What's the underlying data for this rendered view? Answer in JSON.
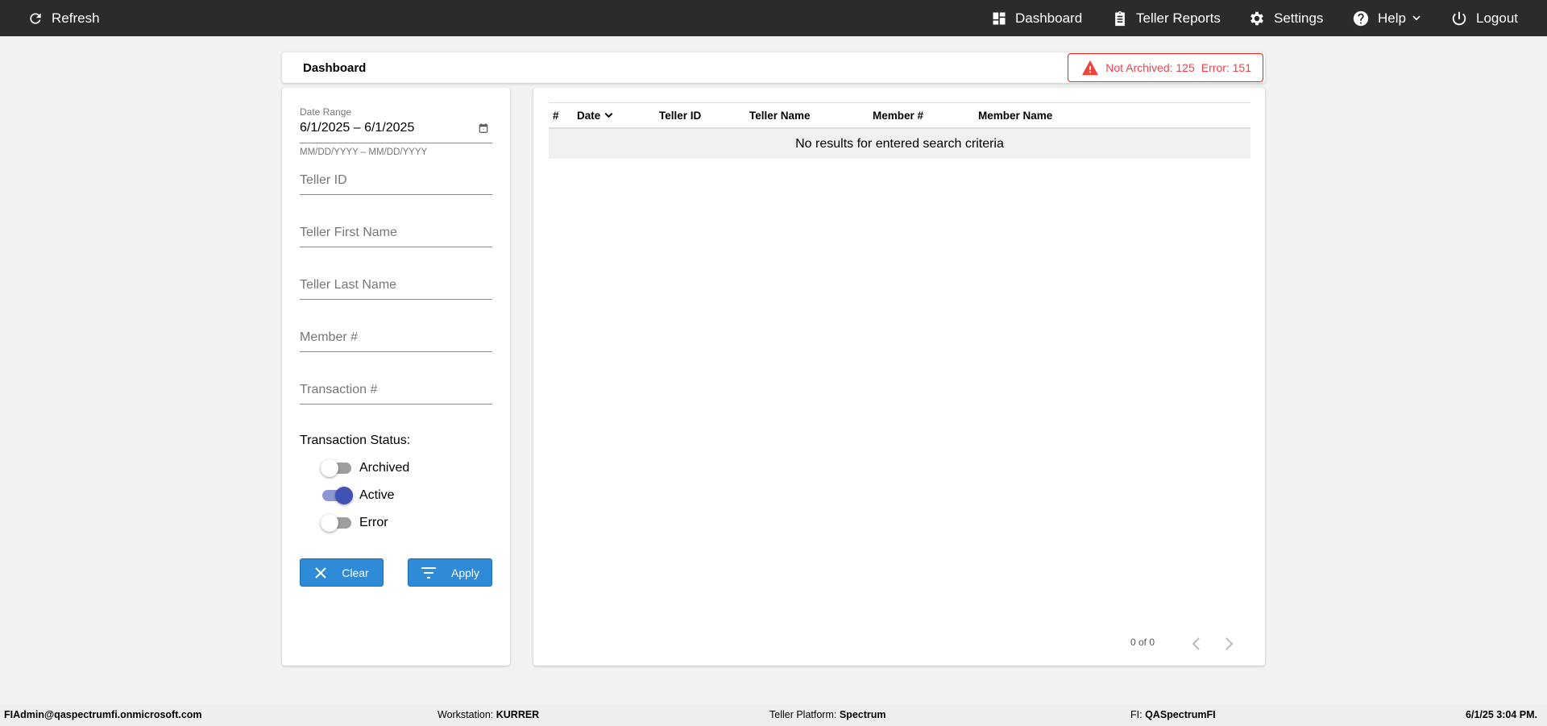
{
  "nav": {
    "refresh": "Refresh",
    "dashboard": "Dashboard",
    "teller_reports": "Teller Reports",
    "settings": "Settings",
    "help": "Help",
    "logout": "Logout"
  },
  "header": {
    "title": "Dashboard",
    "alert_not_archived": "Not Archived: 125",
    "alert_error": "Error: 151",
    "alert_color": "#f0404a"
  },
  "filters": {
    "date_range_label": "Date Range",
    "date_range_value": "6/1/2025 – 6/1/2025",
    "date_hint": "MM/DD/YYYY – MM/DD/YYYY",
    "teller_id": "Teller ID",
    "teller_first_name": "Teller First Name",
    "teller_last_name": "Teller Last Name",
    "member_number": "Member #",
    "transaction_number": "Transaction #",
    "status_label": "Transaction Status:",
    "statuses": [
      {
        "label": "Archived",
        "on": false
      },
      {
        "label": "Active",
        "on": true
      },
      {
        "label": "Error",
        "on": false
      }
    ],
    "clear": "Clear",
    "apply": "Apply"
  },
  "table": {
    "columns": [
      "#",
      "Date",
      "Teller ID",
      "Teller Name",
      "Member #",
      "Member Name"
    ],
    "empty": "No results for entered search criteria",
    "pagination": "0 of 0"
  },
  "footer": {
    "user": "FIAdmin@qaspectrumfi.onmicrosoft.com",
    "workstation_label": "Workstation:",
    "workstation": "KURRER",
    "platform_label": "Teller Platform:",
    "platform": "Spectrum",
    "fi_label": "FI:",
    "fi": "QASpectrumFI",
    "datetime": "6/1/25 3:04 PM."
  }
}
